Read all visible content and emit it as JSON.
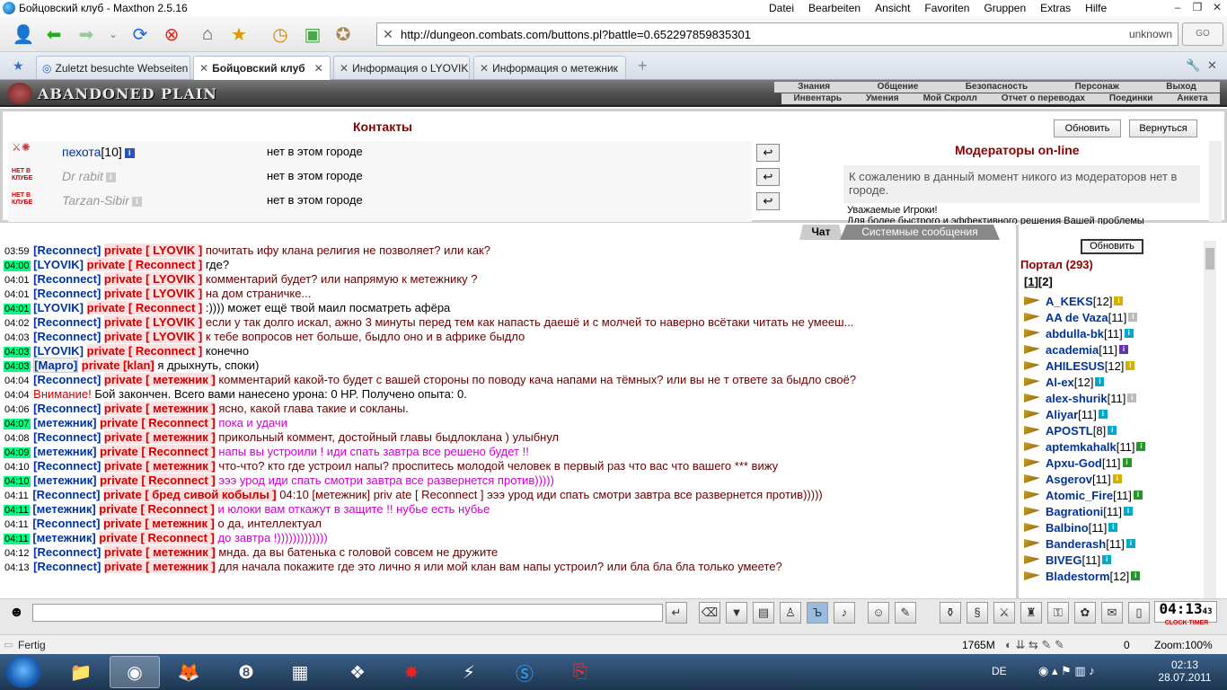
{
  "window": {
    "title": "Бойцовский клуб - Maxthon 2.5.16",
    "menu": [
      "Datei",
      "Bearbeiten",
      "Ansicht",
      "Favoriten",
      "Gruppen",
      "Extras",
      "Hilfe"
    ]
  },
  "browser": {
    "url": "http://dungeon.combats.com/buttons.pl?battle=0.652297859835301",
    "security": "unknown",
    "go_label": "GO",
    "tabs": [
      {
        "label": "Zuletzt besuchte Webseiten",
        "active": false
      },
      {
        "label": "Бойцовский клуб",
        "active": true
      },
      {
        "label": "Информация о LYOVIK",
        "active": false
      },
      {
        "label": "Информация о метежник",
        "active": false
      }
    ],
    "new_tab_label": "+"
  },
  "game": {
    "logo": "ABANDONED PLAIN",
    "nav_primary": [
      "Знания",
      "Общение",
      "Безопасность",
      "Персонаж",
      "Выход"
    ],
    "nav_secondary": [
      "Инвентарь",
      "Умения",
      "Мой Скролл",
      "Отчет о переводах",
      "Поединки",
      "Анкета"
    ]
  },
  "contacts": {
    "title": "Контакты",
    "refresh_label": "Обновить",
    "back_label": "Вернуться",
    "items": [
      {
        "name": "пехота",
        "level": "[10]",
        "location": "нет в этом городе",
        "online": true
      },
      {
        "name": "Dr rabit",
        "level": "",
        "location": "нет в этом городе",
        "online": false
      },
      {
        "name": "Tarzan-Sibir",
        "level": "",
        "location": "нет в этом городе",
        "online": false
      }
    ],
    "badge_offline": "НЕТ В КЛУБЕ"
  },
  "moderators": {
    "title": "Модераторы on-line",
    "message": "К сожалению в данный момент никого из модераторов нет в городе.",
    "note_line1": "Уважаемые Игроки!",
    "note_line2": "Для более быстрого и эффективного решения Вашей проблемы"
  },
  "chat_tabs": {
    "chat": "Чат",
    "system": "Системные сообщения"
  },
  "chat": [
    {
      "time": "03:59",
      "hl": false,
      "from": "[Reconnect]",
      "to": "private [ LYOVIK ]",
      "text": "почитать ифу клана религия не позволяет? или как?",
      "color": "dark"
    },
    {
      "time": "04:00",
      "hl": true,
      "from": "[LYOVIK]",
      "to": "private [ Reconnect ]",
      "text": "где?",
      "color": "black"
    },
    {
      "time": "04:01",
      "hl": false,
      "from": "[Reconnect]",
      "to": "private [ LYOVIK ]",
      "text": "комментарий будет? или напрямую к метежнику ?",
      "color": "dark"
    },
    {
      "time": "04:01",
      "hl": false,
      "from": "[Reconnect]",
      "to": "private [ LYOVIK ]",
      "text": "на дом страничке...",
      "color": "dark"
    },
    {
      "time": "04:01",
      "hl": true,
      "from": "[LYOVIK]",
      "to": "private [ Reconnect ]",
      "text": ":)))) может ещё твой маил посматреть афёра",
      "color": "black"
    },
    {
      "time": "04:02",
      "hl": false,
      "from": "[Reconnect]",
      "to": "private [ LYOVIK ]",
      "text": "если у так долго искал, ажно 3 минуты перед тем как напасть даешё и с молчей то наверно всётаки читать не умееш...",
      "color": "dark"
    },
    {
      "time": "04:03",
      "hl": false,
      "from": "[Reconnect]",
      "to": "private [ LYOVIK ]",
      "text": "к тебе вопросов нет больше, быдло оно и в африке быдло",
      "color": "dark"
    },
    {
      "time": "04:03",
      "hl": true,
      "from": "[LYOVIK]",
      "to": "private [ Reconnect ]",
      "text": "конечно",
      "color": "black"
    },
    {
      "time": "04:03",
      "hl": true,
      "from": "[Марго]",
      "to": "private [klan]",
      "text": "я дрыхнуть, споки)",
      "color": "black",
      "clan": true
    },
    {
      "time": "04:04",
      "hl": false,
      "from": "[Reconnect]",
      "to": "private [ метежник ]",
      "text": "комментарий какой-то будет с вашей стороны по поводу кача напами на тёмных? или вы не т ответе за быдло своё?",
      "color": "dark"
    },
    {
      "time": "04:04",
      "hl": false,
      "warn": "Внимание!",
      "text": "Бой закончен. Всего вами нанесено урона: 0 HP. Получено опыта: 0.",
      "color": "black"
    },
    {
      "time": "04:06",
      "hl": false,
      "from": "[Reconnect]",
      "to": "private [ метежник ]",
      "text": "ясно, какой глава такие и сокланы.",
      "color": "dark"
    },
    {
      "time": "04:07",
      "hl": true,
      "from": "[метежник]",
      "to": "private [ Reconnect ]",
      "text": "пока и удачи",
      "color": "pink"
    },
    {
      "time": "04:08",
      "hl": false,
      "from": "[Reconnect]",
      "to": "private [ метежник ]",
      "text": "прикольный коммент, достойный главы быдлоклана ) улыбнул",
      "color": "dark"
    },
    {
      "time": "04:09",
      "hl": true,
      "from": "[метежник]",
      "to": "private [ Reconnect ]",
      "text": "напы вы устроили ! иди спать завтра все решено будет !!",
      "color": "pink"
    },
    {
      "time": "04:10",
      "hl": false,
      "from": "[Reconnect]",
      "to": "private [ метежник ]",
      "text": "что-что? кто где устроил напы? проспитесь молодой человек в первый раз что вас что вашего *** вижу",
      "color": "dark"
    },
    {
      "time": "04:10",
      "hl": true,
      "from": "[метежник]",
      "to": "private [ Reconnect ]",
      "text": "эээ урод иди спать смотри завтра все развернется против)))))",
      "color": "pink"
    },
    {
      "time": "04:11",
      "hl": false,
      "from": "[Reconnect]",
      "to": "private [ бред сивой кобылы ]",
      "text": "04:10 [метежник] priv ate [ Reconnect ] эээ урод иди спать смотри завтра все развернется против)))))",
      "color": "dark"
    },
    {
      "time": "04:11",
      "hl": true,
      "from": "[метежник]",
      "to": "private [ Reconnect ]",
      "text": "и юлоки вам откажут в защите !! нубье есть нубье",
      "color": "pink"
    },
    {
      "time": "04:11",
      "hl": false,
      "from": "[Reconnect]",
      "to": "private [ метежник ]",
      "text": "о да, интеллектуал",
      "color": "dark"
    },
    {
      "time": "04:11",
      "hl": true,
      "from": "[метежник]",
      "to": "private [ Reconnect ]",
      "text": "до завтра !)))))))))))))",
      "color": "pink"
    },
    {
      "time": "04:12",
      "hl": false,
      "from": "[Reconnect]",
      "to": "private [ метежник ]",
      "text": "мнда. да вы батенька с головой совсем не дружите",
      "color": "dark"
    },
    {
      "time": "04:13",
      "hl": false,
      "from": "[Reconnect]",
      "to": "private [ метежник ]",
      "text": "для начала покажите где это лично я или мой клан вам напы устроил? или бла бла бла только умеете?",
      "color": "dark"
    }
  ],
  "portal": {
    "refresh_label": "Обновить",
    "title": "Портал (293)",
    "pages": [
      "1",
      "2"
    ],
    "players": [
      {
        "name": "A_KEKS",
        "level": "[12]",
        "inf": "y"
      },
      {
        "name": "AA de Vaza",
        "level": "[11]",
        "inf": "gr"
      },
      {
        "name": "abdulla-bk",
        "level": "[11]",
        "inf": "c"
      },
      {
        "name": "academia",
        "level": "[11]",
        "inf": "v"
      },
      {
        "name": "AHILESUS",
        "level": "[12]",
        "inf": "y"
      },
      {
        "name": "Al-ex",
        "level": "[12]",
        "inf": "c"
      },
      {
        "name": "alex-shurik",
        "level": "[11]",
        "inf": "gr"
      },
      {
        "name": "Aliyar",
        "level": "[11]",
        "inf": "c"
      },
      {
        "name": "APOSTL",
        "level": "[8]",
        "inf": "c"
      },
      {
        "name": "aptemkahalk",
        "level": "[11]",
        "inf": "g"
      },
      {
        "name": "Apxu-God",
        "level": "[11]",
        "inf": "g"
      },
      {
        "name": "Asgerov",
        "level": "[11]",
        "inf": "y"
      },
      {
        "name": "Atomic_Fire",
        "level": "[11]",
        "inf": "g"
      },
      {
        "name": "Bagrationi",
        "level": "[11]",
        "inf": "c"
      },
      {
        "name": "Balbino",
        "level": "[11]",
        "inf": "c"
      },
      {
        "name": "Banderash",
        "level": "[11]",
        "inf": "c"
      },
      {
        "name": "BIVEG",
        "level": "[11]",
        "inf": "c"
      },
      {
        "name": "Bladestorm",
        "level": "[12]",
        "inf": "g"
      }
    ]
  },
  "timer": {
    "time": "04:13",
    "seconds": "43",
    "label": "CLOCK TIMER"
  },
  "status": {
    "text": "Fertig",
    "memory": "1765M",
    "counter": "0",
    "zoom": "Zoom:100%"
  },
  "taskbar": {
    "lang": "DE",
    "time": "02:13",
    "date": "28.07.2011"
  }
}
